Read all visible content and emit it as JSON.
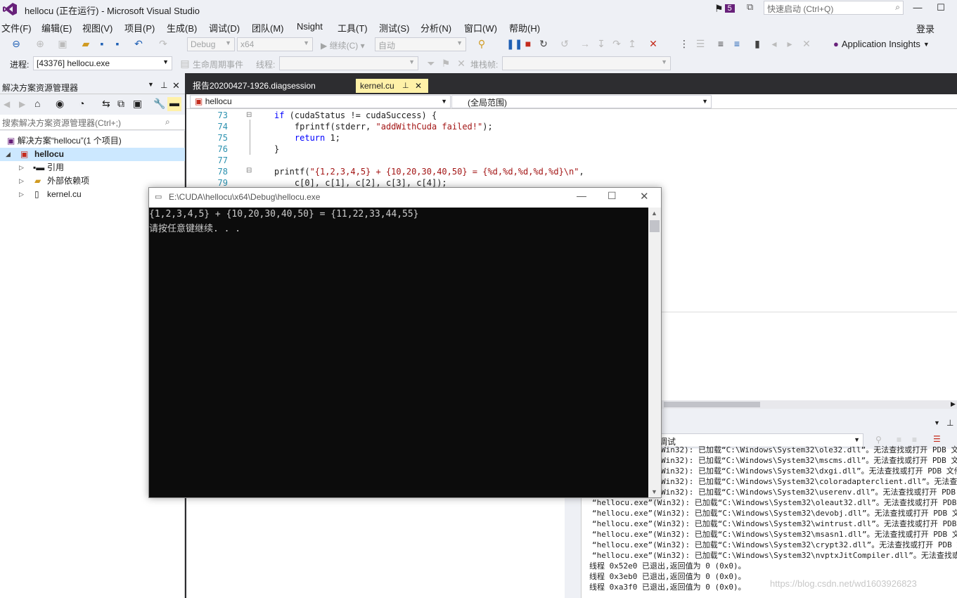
{
  "window": {
    "title": "hellocu (正在运行) - Microsoft Visual Studio",
    "notification_count": "5",
    "quick_launch_placeholder": "快速启动 (Ctrl+Q)",
    "signin": "登录"
  },
  "menu": [
    "文件(F)",
    "编辑(E)",
    "视图(V)",
    "项目(P)",
    "生成(B)",
    "调试(D)",
    "团队(M)",
    "Nsight",
    "工具(T)",
    "测试(S)",
    "分析(N)",
    "窗口(W)",
    "帮助(H)"
  ],
  "toolbar": {
    "config": "Debug",
    "platform": "x64",
    "continue_label": "继续(C)",
    "auto": "自动",
    "app_insights": "Application Insights"
  },
  "debug_bar": {
    "process_label": "进程:",
    "process_value": "[43376] hellocu.exe",
    "lifecycle_label": "生命周期事件",
    "thread_label": "线程:",
    "stack_label": "堆栈帧:"
  },
  "solution_explorer": {
    "title": "解决方案资源管理器",
    "search_placeholder": "搜索解决方案资源管理器(Ctrl+;)",
    "solution": "解决方案“hellocu”(1 个项目)",
    "project": "hellocu",
    "items": [
      "引用",
      "外部依赖项",
      "kernel.cu"
    ]
  },
  "tabs": [
    "报告20200427-1926.diagsession",
    "kernel.cu"
  ],
  "nav": {
    "scope1": "hellocu",
    "scope2": "(全局范围)"
  },
  "code": {
    "line_numbers": [
      "73",
      "74",
      "75",
      "76",
      "77",
      "78",
      "79"
    ],
    "lines": [
      "if (cudaStatus != cudaSuccess) {",
      "    fprintf(stderr, \"addWithCuda failed!\");",
      "    return 1;",
      "}",
      "",
      "printf(\"{1,2,3,4,5} + {10,20,30,40,50} = {%d,%d,%d,%d,%d}\\n\",",
      "    c[0], c[1], c[2], c[3], c[4]);"
    ]
  },
  "output": {
    "source_tail": "调试",
    "lines": [
      "Win32): 已加载“C:\\Windows\\System32\\ole32.dll”。无法查找或打开 PDB 文件",
      "Win32): 已加载“C:\\Windows\\System32\\mscms.dll”。无法查找或打开 PDB 文件",
      "Win32): 已加载“C:\\Windows\\System32\\dxgi.dll”。无法查找或打开 PDB 文件",
      "Win32): 已加载“C:\\Windows\\System32\\coloradapterclient.dll”。无法查找或",
      "Win32): 已加载“C:\\Windows\\System32\\userenv.dll”。无法查找或打开 PDB 文",
      "“hellocu.exe”(Win32): 已加载“C:\\Windows\\System32\\oleaut32.dll”。无法查找或打开 PDB",
      "“hellocu.exe”(Win32): 已加载“C:\\Windows\\System32\\devobj.dll”。无法查找或打开 PDB 文",
      "“hellocu.exe”(Win32): 已加载“C:\\Windows\\System32\\wintrust.dll”。无法查找或打开 PDB",
      "“hellocu.exe”(Win32): 已加载“C:\\Windows\\System32\\msasn1.dll”。无法查找或打开 PDB 文",
      "“hellocu.exe”(Win32): 已加载“C:\\Windows\\System32\\crypt32.dll”。无法查找或打开 PDB 文",
      "“hellocu.exe”(Win32): 已加载“C:\\Windows\\System32\\nvptxJitCompiler.dll”。无法查找或打",
      "线程 0x52e0 已退出,返回值为 0 (0x0)。",
      "线程 0x3eb0 已退出,返回值为 0 (0x0)。",
      "线程 0xa3f0 已退出,返回值为 0 (0x0)。"
    ]
  },
  "console": {
    "title": "E:\\CUDA\\hellocu\\x64\\Debug\\hellocu.exe",
    "lines": [
      "{1,2,3,4,5} + {10,20,30,40,50} = {11,22,33,44,55}",
      "请按任意键继续. . ."
    ]
  },
  "watermark": "https://blog.csdn.net/wd1603926823",
  "colors": {
    "accent": "#68217a",
    "tab_active": "#fff1a8",
    "doc_well": "#2d2d30",
    "selection": "#cce8ff"
  }
}
